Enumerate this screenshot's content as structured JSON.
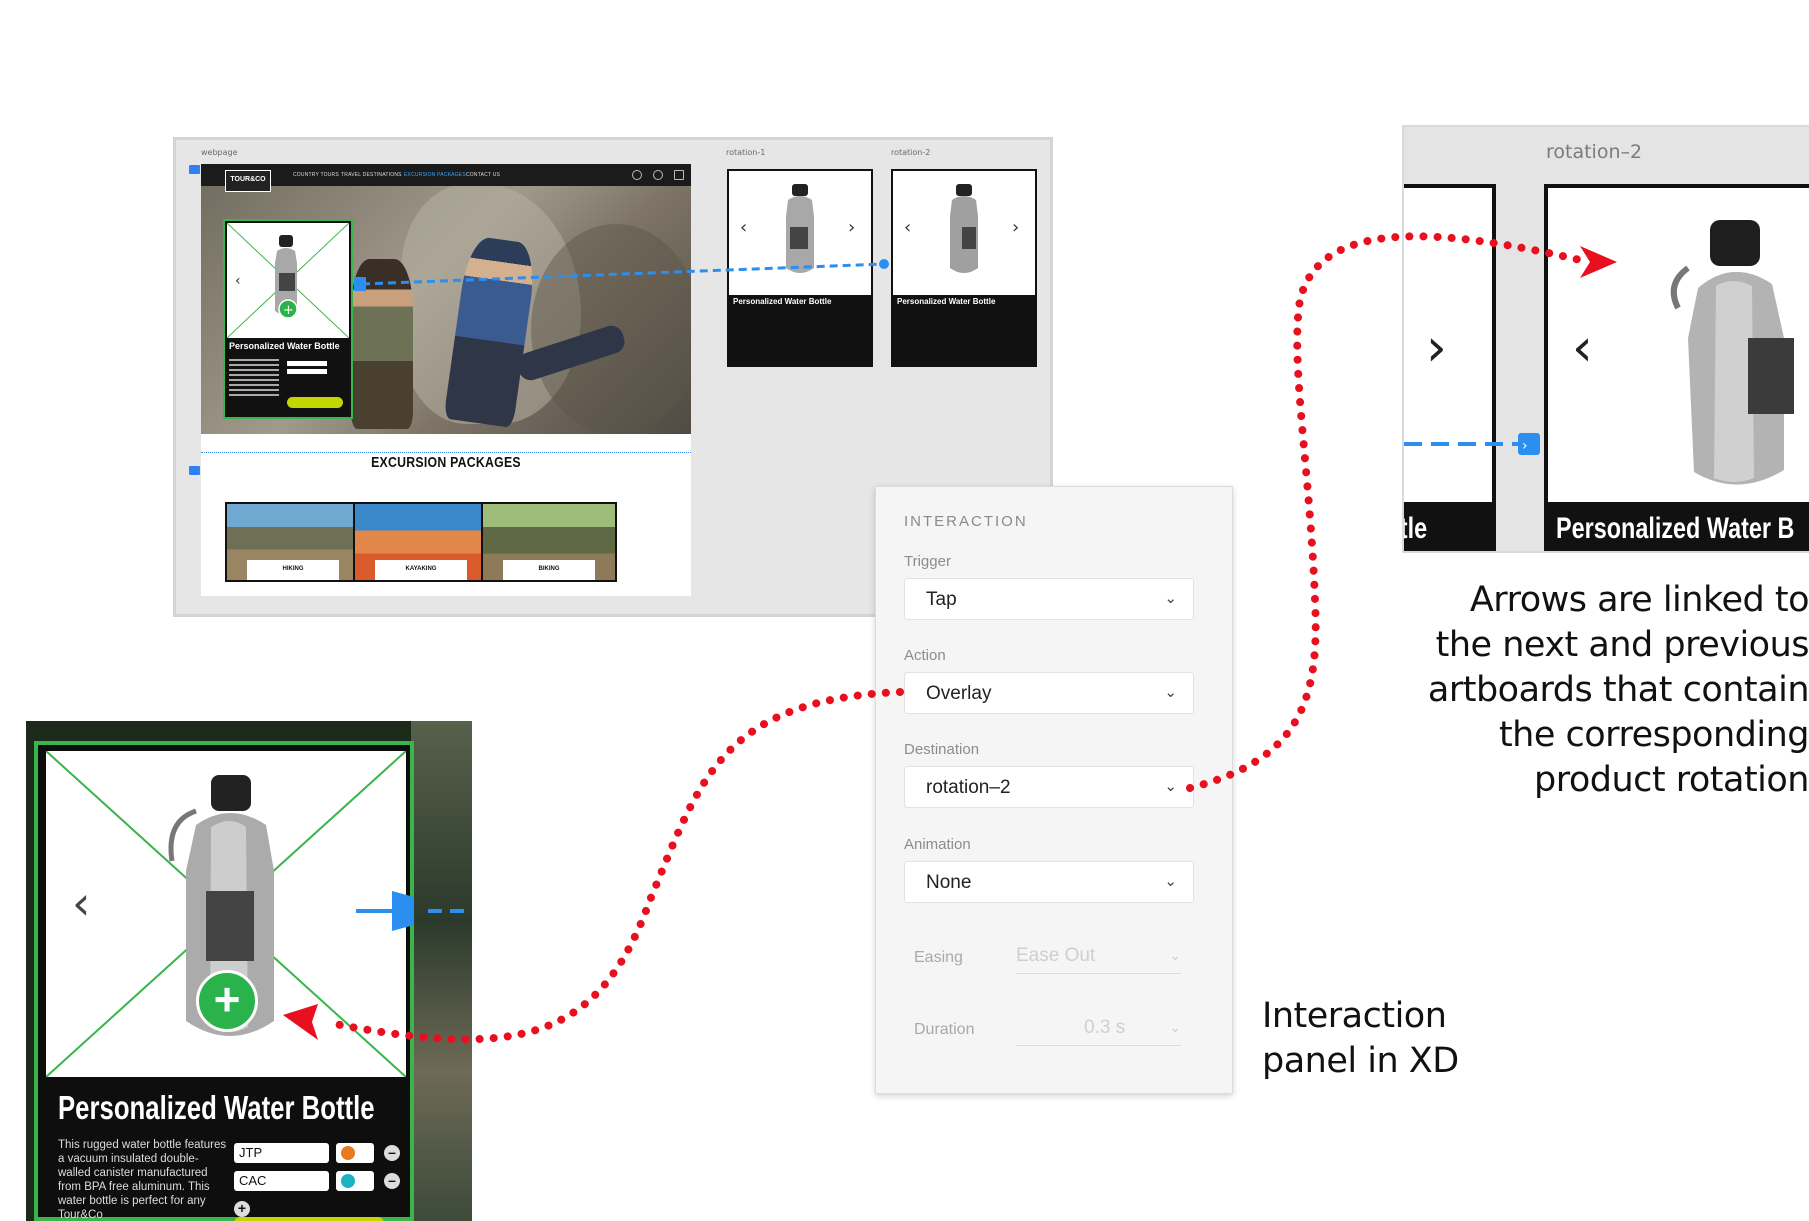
{
  "canvas": {
    "artboards": {
      "webpage": "webpage",
      "rotation1": "rotation-1",
      "rotation2": "rotation-2"
    },
    "nav": {
      "logo": "TOUR&CO",
      "items": [
        "COUNTRY TOURS",
        "TRAVEL DESTINATIONS",
        "EXCURSION PACKAGES",
        "CONTACT US"
      ],
      "active_index": 2
    },
    "product_title": "Personalized Water Bottle",
    "section_title": "EXCURSION PACKAGES",
    "packages": [
      "HIKING",
      "KAYAKING",
      "BIKING"
    ]
  },
  "panel": {
    "title": "INTERACTION",
    "trigger_label": "Trigger",
    "trigger_value": "Tap",
    "action_label": "Action",
    "action_value": "Overlay",
    "destination_label": "Destination",
    "destination_value": "rotation–2",
    "animation_label": "Animation",
    "animation_value": "None",
    "easing_label": "Easing",
    "easing_value": "Ease Out",
    "duration_label": "Duration",
    "duration_value": "0.3 s"
  },
  "zoom_right": {
    "artboard_label": "rotation–2",
    "left_title": "ttle",
    "right_title": "Personalized Water B"
  },
  "captions": {
    "arrows_lines": [
      "Arrows are linked to",
      "the next and previous",
      "artboards that contain",
      "the corresponding",
      "product rotation"
    ],
    "panel_lines": [
      "Interaction",
      "panel in XD"
    ]
  },
  "zoom_left": {
    "title": "Personalized Water Bottle",
    "description": "This rugged water bottle features a vacuum insulated double-walled canister manufactured from BPA free aluminum. This water bottle is perfect for any Tour&Co",
    "field1": "JTP",
    "field2": "CAC"
  },
  "colors": {
    "accent_green": "#39b54a",
    "hotspot_blue": "#2f7ff5",
    "link_red": "#e8101f",
    "add_button_green": "#29b34a",
    "lime_button": "#c3d600"
  }
}
